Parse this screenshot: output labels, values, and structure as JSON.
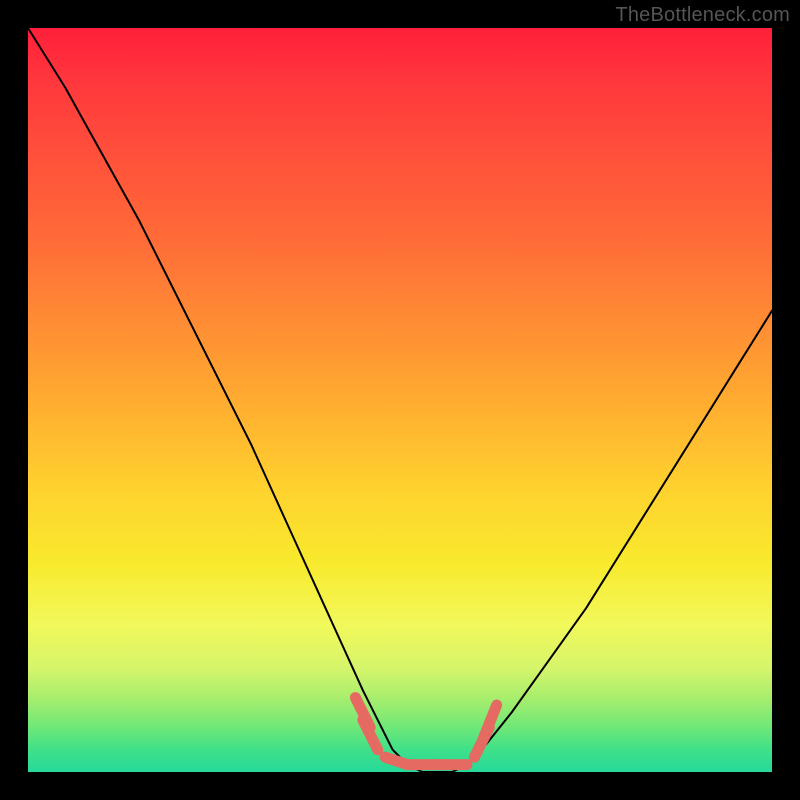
{
  "watermark": "TheBottleneck.com",
  "chart_data": {
    "type": "line",
    "title": "",
    "xlabel": "",
    "ylabel": "",
    "xlim": [
      0,
      100
    ],
    "ylim": [
      0,
      100
    ],
    "grid": false,
    "legend": false,
    "series": [
      {
        "name": "curve",
        "x": [
          0,
          5,
          10,
          15,
          20,
          25,
          30,
          35,
          40,
          45,
          47,
          49,
          51,
          53,
          55,
          57,
          59,
          61,
          65,
          70,
          75,
          80,
          85,
          90,
          95,
          100
        ],
        "values": [
          100,
          92,
          83,
          74,
          64,
          54,
          44,
          33,
          22,
          11,
          7,
          3,
          1,
          0,
          0,
          0,
          1,
          3,
          8,
          15,
          22,
          30,
          38,
          46,
          54,
          62
        ]
      }
    ],
    "markers": {
      "name": "highlight-pills",
      "color": "#e46a62",
      "segments": [
        {
          "x1": 44,
          "y1": 10,
          "x2": 46,
          "y2": 6
        },
        {
          "x1": 45,
          "y1": 7,
          "x2": 47,
          "y2": 3
        },
        {
          "x1": 48,
          "y1": 2,
          "x2": 51,
          "y2": 1
        },
        {
          "x1": 51,
          "y1": 1,
          "x2": 55,
          "y2": 1
        },
        {
          "x1": 55,
          "y1": 1,
          "x2": 59,
          "y2": 1
        },
        {
          "x1": 60,
          "y1": 2,
          "x2": 62,
          "y2": 6
        },
        {
          "x1": 61,
          "y1": 4,
          "x2": 63,
          "y2": 9
        }
      ]
    },
    "background_gradient": {
      "top_color": "#ff1f3a",
      "mid_color": "#ffd22e",
      "bottom_color": "#26d99a"
    }
  }
}
